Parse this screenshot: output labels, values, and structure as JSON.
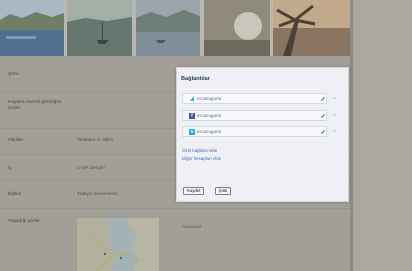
{
  "form": {
    "fields": [
      {
        "label": "Şehir",
        "value": ""
      },
      {
        "label": "Hayatta önemli gördüğün şeyler",
        "value": ""
      },
      {
        "label": "Okullar",
        "value": "Yeditepe Ü. Bilim"
      },
      {
        "label": "İş",
        "value": "CHIP Dergisi"
      },
      {
        "label": "Eğitim",
        "value": "Trakya Üniversitesi"
      },
      {
        "label": "Yaşadığı yerler",
        "value": ""
      }
    ],
    "map_hint": "Ana karar"
  },
  "dialog": {
    "title": "Bağlantılar",
    "accounts": [
      {
        "service": "twitter",
        "icon": "twitter-icon",
        "color": "#2aa3d9",
        "username": "ercanugurlu"
      },
      {
        "service": "facebook",
        "icon": "facebook-icon",
        "color": "#3b5998",
        "username": "ercanugurlu"
      },
      {
        "service": "skype",
        "icon": "skype-icon",
        "color": "#21a9e1",
        "username": "ercanugurlu"
      }
    ],
    "links": [
      "Özel bağlantı ekle",
      "Diğer hesapları ekle"
    ],
    "save_label": "Kaydet",
    "cancel_label": "İptal"
  },
  "colors": {
    "accent_link": "#3f6fb3",
    "dialog_bg": "#eef0f6",
    "overlay": "#a19f97"
  }
}
